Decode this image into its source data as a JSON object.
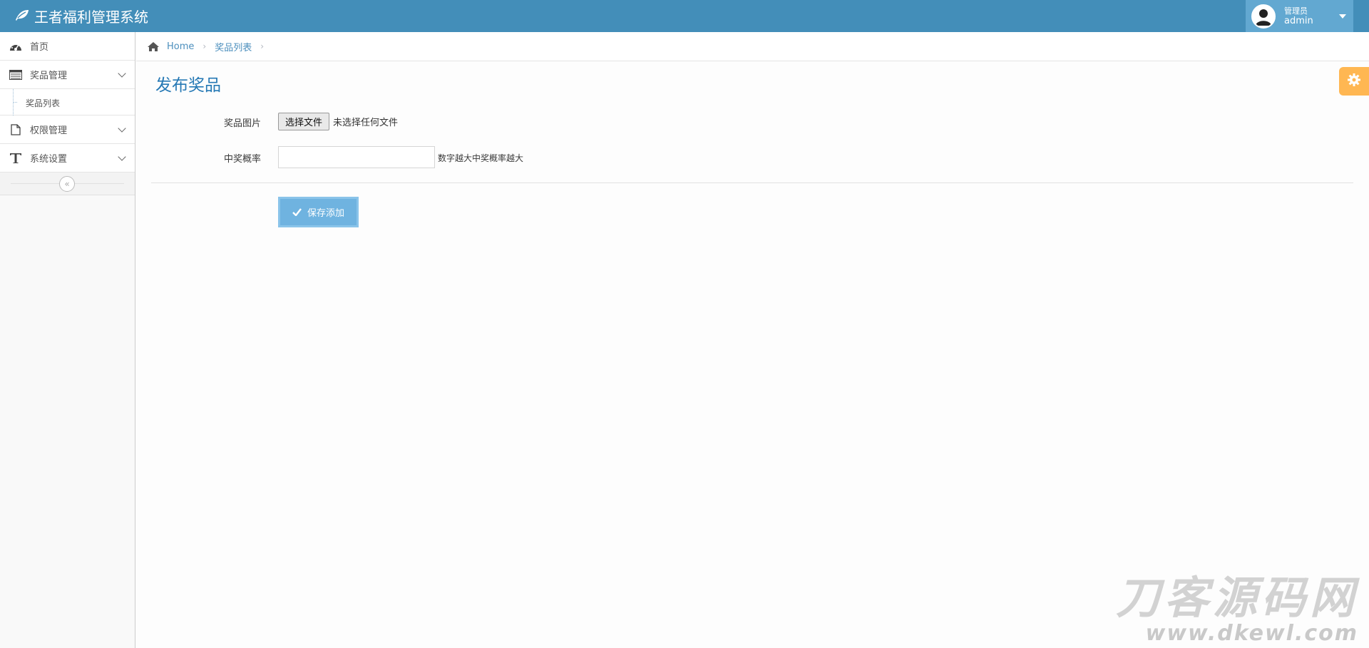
{
  "app": {
    "title": "王者福利管理系统"
  },
  "user": {
    "role": "管理员",
    "name": "admin"
  },
  "sidebar": {
    "items": [
      {
        "label": "首页",
        "icon": "dashboard-icon"
      },
      {
        "label": "奖品管理",
        "icon": "list-icon",
        "expanded": true,
        "children": [
          {
            "label": "奖品列表"
          }
        ]
      },
      {
        "label": "权限管理",
        "icon": "file-icon"
      },
      {
        "label": "系统设置",
        "icon": "text-icon"
      }
    ],
    "collapse_symbol": "«"
  },
  "breadcrumb": {
    "home": "Home",
    "current": "奖品列表"
  },
  "page": {
    "title": "发布奖品"
  },
  "form": {
    "image_label": "奖品图片",
    "file_button": "选择文件",
    "file_status": "未选择任何文件",
    "prob_label": "中奖概率",
    "prob_value": "",
    "prob_help": "数字越大中奖概率越大",
    "save_label": "保存添加"
  },
  "watermark": {
    "cn": "刀客源码网",
    "url": "www.dkewl.com"
  },
  "colors": {
    "navbar": "#438eb9",
    "user_box": "#62a8d1",
    "title": "#2679b5",
    "save_button": "#6fb3e0",
    "settings_tab": "#ffb752"
  }
}
